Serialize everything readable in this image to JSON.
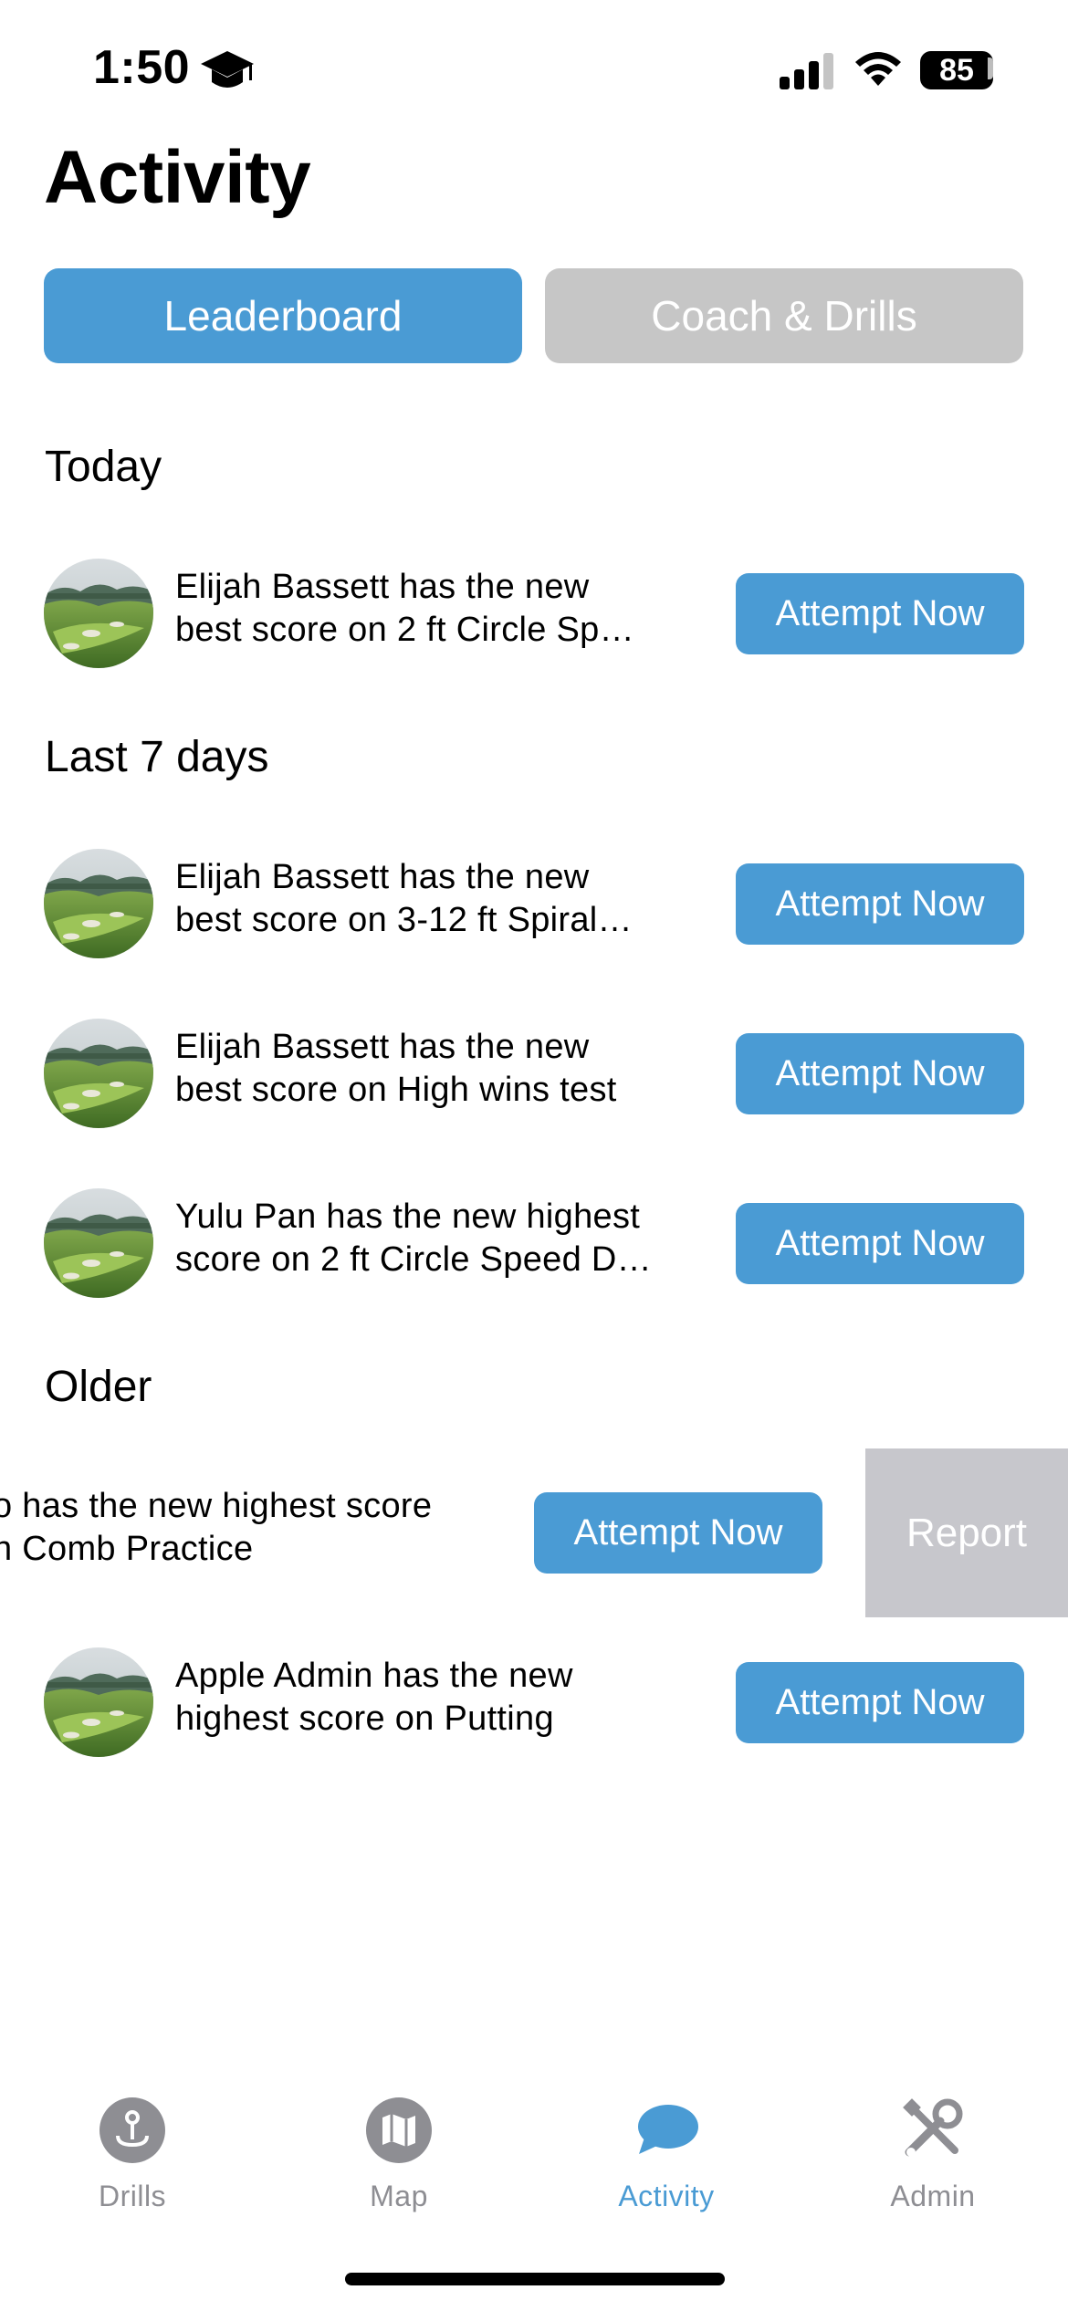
{
  "status_bar": {
    "time": "1:50",
    "battery": "85"
  },
  "page": {
    "title": "Activity"
  },
  "segments": {
    "leaderboard": "Leaderboard",
    "coach_drills": "Coach & Drills",
    "selected": "Leaderboard"
  },
  "sections": [
    {
      "title": "Today",
      "items": [
        {
          "line1": "Elijah Bassett has the new",
          "line2": "best score on 2 ft Circle Sp…",
          "button": "Attempt Now"
        }
      ]
    },
    {
      "title": "Last 7 days",
      "items": [
        {
          "line1": "Elijah Bassett has the new",
          "line2": "best score on 3-12 ft Spiral…",
          "button": "Attempt Now"
        },
        {
          "line1": "Elijah Bassett has the new",
          "line2": "best score on High wins test",
          "button": "Attempt Now"
        },
        {
          "line1": "Yulu Pan has the new highest",
          "line2": "score on 2 ft Circle Speed D…",
          "button": "Attempt Now"
        }
      ]
    },
    {
      "title": "Older",
      "items": [
        {
          "line1": "o has the new highest score",
          "line2": "n Comb Practice",
          "button": "Attempt Now",
          "swipe_action": "Report"
        },
        {
          "line1": "Apple Admin has the new",
          "line2": "highest score on Putting",
          "button": "Attempt Now"
        }
      ]
    }
  ],
  "tab_bar": {
    "tabs": [
      {
        "label": "Drills",
        "icon": "drills-pin-icon"
      },
      {
        "label": "Map",
        "icon": "map-icon"
      },
      {
        "label": "Activity",
        "icon": "chat-bubble-icon",
        "active": true
      },
      {
        "label": "Admin",
        "icon": "tools-icon"
      }
    ]
  },
  "colors": {
    "accent": "#4a9bd4",
    "inactive_segment": "#c6c6c6",
    "report_bg": "#c7c7cc",
    "tab_inactive": "#8e8e93"
  }
}
